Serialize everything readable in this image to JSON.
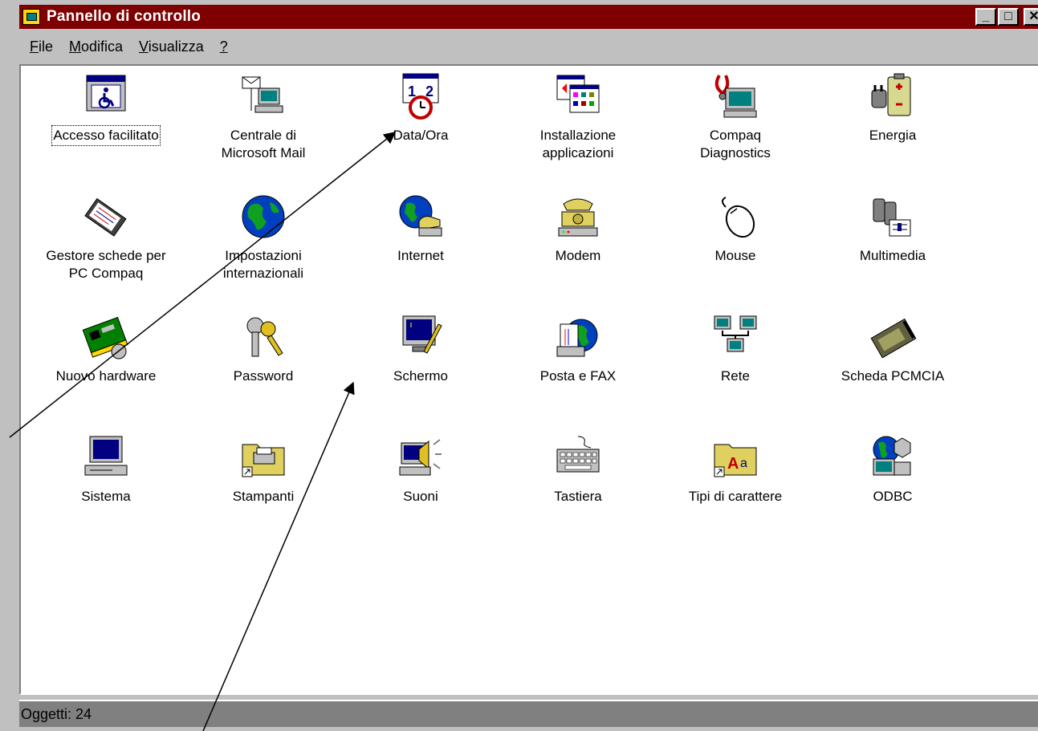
{
  "window": {
    "title": "Pannello di controllo"
  },
  "title_buttons": {
    "minimize": "_",
    "maximize": "□",
    "close": "✕"
  },
  "menu": [
    {
      "label": "File",
      "underline_first": true
    },
    {
      "label": "Modifica",
      "underline_first": true
    },
    {
      "label": "Visualizza",
      "underline_first": true
    },
    {
      "label": "?",
      "underline_first": true
    }
  ],
  "items": [
    {
      "label": "Accesso facilitato",
      "icon": "accessibility-icon"
    },
    {
      "label": "Centrale di\nMicrosoft Mail",
      "icon": "mail-icon"
    },
    {
      "label": "Data/Ora",
      "icon": "clock-calendar-icon"
    },
    {
      "label": "Installazione\napplicazioni",
      "icon": "install-icon"
    },
    {
      "label": "Compaq\nDiagnostics",
      "icon": "diagnostics-icon"
    },
    {
      "label": "Energia",
      "icon": "power-icon"
    },
    {
      "label": "Gestore schede per\nPC Compaq",
      "icon": "pccard-manager-icon"
    },
    {
      "label": "Impostazioni\ninternazionali",
      "icon": "globe-icon"
    },
    {
      "label": "Internet",
      "icon": "internet-icon"
    },
    {
      "label": "Modem",
      "icon": "modem-icon"
    },
    {
      "label": "Mouse",
      "icon": "mouse-icon"
    },
    {
      "label": "Multimedia",
      "icon": "multimedia-icon"
    },
    {
      "label": "Nuovo hardware",
      "icon": "hardware-icon"
    },
    {
      "label": "Password",
      "icon": "keys-icon"
    },
    {
      "label": "Schermo",
      "icon": "display-icon"
    },
    {
      "label": "Posta e FAX",
      "icon": "mail-fax-icon"
    },
    {
      "label": "Rete",
      "icon": "network-icon"
    },
    {
      "label": "Scheda PCMCIA",
      "icon": "pcmcia-icon"
    },
    {
      "label": "Sistema",
      "icon": "computer-icon"
    },
    {
      "label": "Stampanti",
      "icon": "printer-folder-icon"
    },
    {
      "label": "Suoni",
      "icon": "speaker-icon"
    },
    {
      "label": "Tastiera",
      "icon": "keyboard-icon"
    },
    {
      "label": "Tipi di carattere",
      "icon": "fonts-folder-icon"
    },
    {
      "label": "ODBC",
      "icon": "odbc-icon"
    }
  ],
  "selected_item": "Accesso facilitato",
  "status": {
    "text": "Oggetti: 24"
  },
  "colors": {
    "titlebar": "#7f0000",
    "face": "#c0c0c0",
    "status": "#808080"
  }
}
